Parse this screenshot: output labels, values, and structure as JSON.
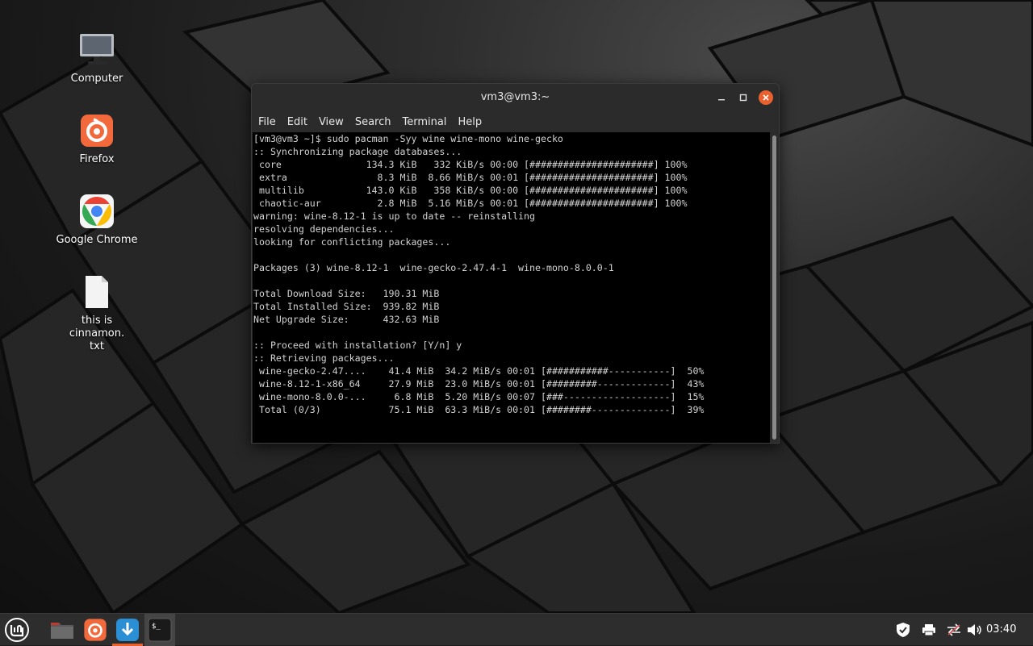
{
  "desktop": {
    "icons": [
      {
        "label": "Computer",
        "icon": "computer-icon"
      },
      {
        "label": "Firefox",
        "icon": "firefox-icon"
      },
      {
        "label": "Google Chrome",
        "icon": "chrome-icon"
      },
      {
        "label": "this is cinnamon.\ntxt",
        "icon": "text-file-icon"
      }
    ]
  },
  "window": {
    "title": "vm3@vm3:~",
    "menu": [
      "File",
      "Edit",
      "View",
      "Search",
      "Terminal",
      "Help"
    ],
    "terminal_output": "[vm3@vm3 ~]$ sudo pacman -Syy wine wine-mono wine-gecko\n:: Synchronizing package databases...\n core               134.3 KiB   332 KiB/s 00:00 [######################] 100%\n extra                8.3 MiB  8.66 MiB/s 00:01 [######################] 100%\n multilib           143.0 KiB   358 KiB/s 00:00 [######################] 100%\n chaotic-aur          2.8 MiB  5.16 MiB/s 00:01 [######################] 100%\nwarning: wine-8.12-1 is up to date -- reinstalling\nresolving dependencies...\nlooking for conflicting packages...\n\nPackages (3) wine-8.12-1  wine-gecko-2.47.4-1  wine-mono-8.0.0-1\n\nTotal Download Size:   190.31 MiB\nTotal Installed Size:  939.82 MiB\nNet Upgrade Size:      432.63 MiB\n\n:: Proceed with installation? [Y/n] y\n:: Retrieving packages...\n wine-gecko-2.47....    41.4 MiB  34.2 MiB/s 00:01 [###########-----------]  50%\n wine-8.12-1-x86_64     27.9 MiB  23.0 MiB/s 00:01 [#########-------------]  43%\n wine-mono-8.0.0-...     6.8 MiB  5.20 MiB/s 00:07 [###-------------------]  15%\n Total (0/3)            75.1 MiB  63.3 MiB/s 00:01 [########--------------]  39%"
  },
  "taskbar": {
    "launchers": [
      "menu-icon",
      "files-icon",
      "firefox-icon",
      "download-icon",
      "terminal-icon"
    ],
    "tray": [
      "shield-icon",
      "printer-icon",
      "network-icon",
      "volume-icon"
    ],
    "clock": "03:40",
    "colors": {
      "accent": "#e9612e",
      "panel": "#2d2d2d"
    }
  }
}
